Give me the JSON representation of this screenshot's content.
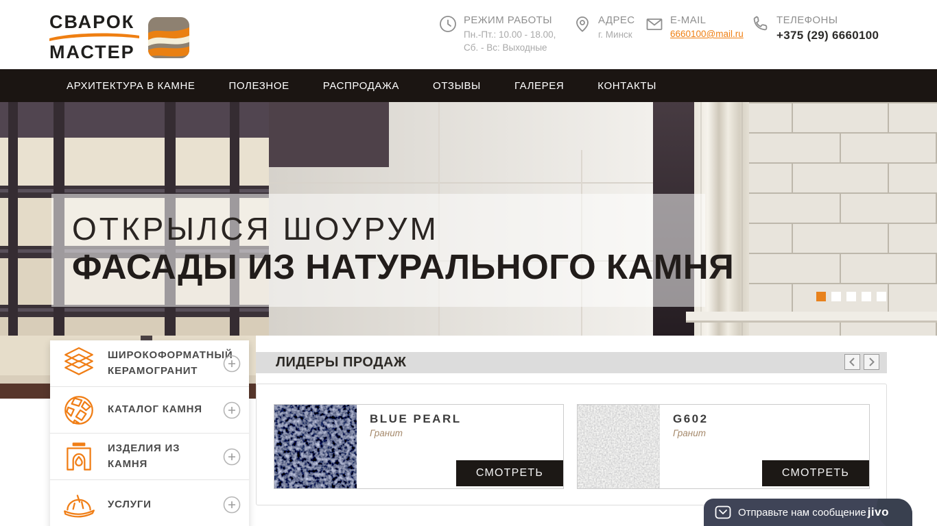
{
  "brand": {
    "name_line1": "СВАРОК",
    "name_line2": "МАСТЕР"
  },
  "header": {
    "work_hours": {
      "label": "РЕЖИМ РАБОТЫ",
      "line1": "Пн.-Пт.: 10.00 - 18.00,",
      "line2": "Сб. - Вс: Выходные"
    },
    "address": {
      "label": "АДРЕС",
      "value": "г. Минск"
    },
    "email": {
      "label": "E-MAIL",
      "value": "6660100@mail.ru"
    },
    "phones": {
      "label": "ТЕЛЕФОНЫ",
      "value": "+375 (29) 6660100"
    }
  },
  "nav": {
    "items": [
      {
        "label": "АРХИТЕКТУРА В КАМНЕ"
      },
      {
        "label": "ПОЛЕЗНОЕ"
      },
      {
        "label": "РАСПРОДАЖА"
      },
      {
        "label": "ОТЗЫВЫ"
      },
      {
        "label": "ГАЛЕРЕЯ"
      },
      {
        "label": "КОНТАКТЫ"
      }
    ]
  },
  "hero": {
    "title_line1": "ОТКРЫЛСЯ ШОУРУМ",
    "title_line2": "ФАСАДЫ ИЗ НАТУРАЛЬНОГО КАМНЯ",
    "slide_count": 5,
    "active_slide_index": 0
  },
  "sidebar": {
    "items": [
      {
        "label": "ШИРОКОФОРМАТНЫЙ КЕРАМОГРАНИТ",
        "icon": "ceramic-layers-icon"
      },
      {
        "label": "КАТАЛОГ КАМНЯ",
        "icon": "stone-sphere-icon"
      },
      {
        "label": "ИЗДЕЛИЯ ИЗ КАМНЯ",
        "icon": "fireplace-icon"
      },
      {
        "label": "УСЛУГИ",
        "icon": "hard-hat-icon"
      }
    ]
  },
  "bestsellers": {
    "title": "ЛИДЕРЫ ПРОДАЖ",
    "products": [
      {
        "name": "BLUE PEARL",
        "material": "Гранит",
        "button_label": "СМОТРЕТЬ",
        "texture": "dark-blue-granite"
      },
      {
        "name": "G602",
        "material": "Гранит",
        "button_label": "СМОТРЕТЬ",
        "texture": "light-gray-granite"
      }
    ]
  },
  "chat_widget": {
    "message": "Отправьте нам сообщение",
    "brand": "jivo"
  },
  "colors": {
    "accent_orange": "#ee7d1a",
    "nav_background": "#1b1512",
    "view_button_background": "#1c1815",
    "chat_background": "#3f4457",
    "section_bar_background": "#dcdcdc"
  }
}
